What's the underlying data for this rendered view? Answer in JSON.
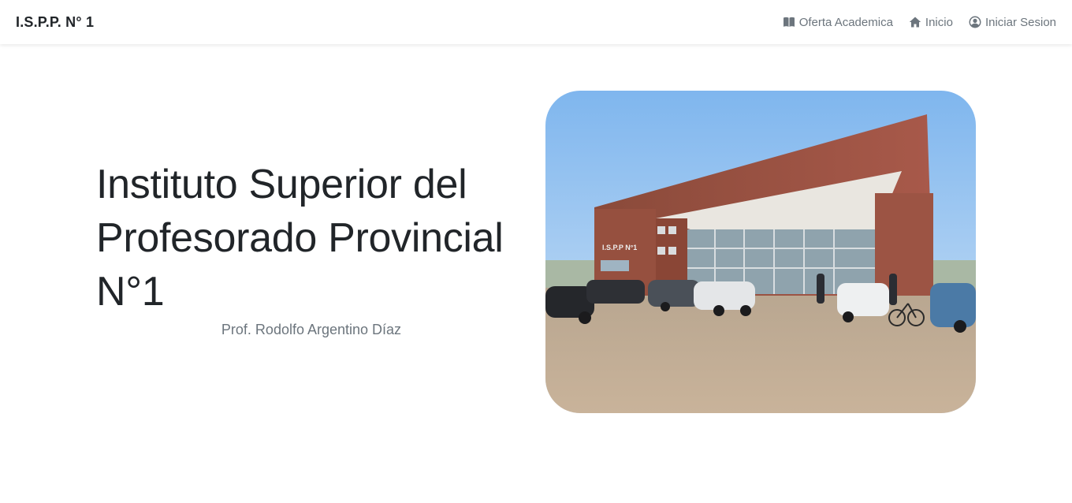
{
  "navbar": {
    "brand": "I.S.P.P. N° 1",
    "links": [
      {
        "label": "Oferta Academica",
        "icon": "book-icon"
      },
      {
        "label": "Inicio",
        "icon": "home-icon"
      },
      {
        "label": "Iniciar Sesion",
        "icon": "user-circle-icon"
      }
    ]
  },
  "hero": {
    "title_line1": "Instituto Superior del",
    "title_line2": "Profesorado Provincial",
    "title_line3": "N°1",
    "subtitle": "Prof. Rodolfo Argentino Díaz",
    "image_sign": "I.S.P.P N°1"
  },
  "colors": {
    "text": "#212529",
    "muted": "#6c757d",
    "background": "#ffffff"
  }
}
